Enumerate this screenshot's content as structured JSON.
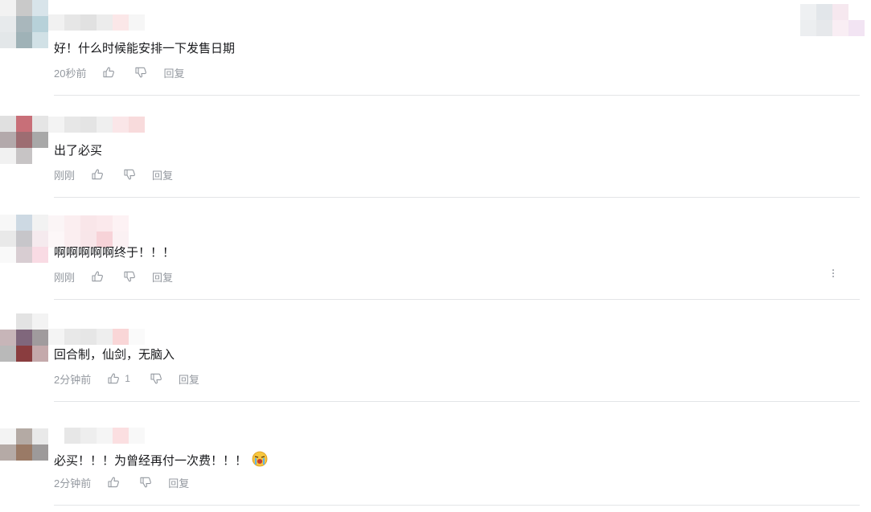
{
  "comments": [
    {
      "text": "好！什么时候能安排一下发售日期",
      "time": "20秒前",
      "like_count": "",
      "reply_label": "回复",
      "has_emoji": false,
      "show_more": false
    },
    {
      "text": "出了必买",
      "time": "刚刚",
      "like_count": "",
      "reply_label": "回复",
      "has_emoji": false,
      "show_more": false
    },
    {
      "text": "啊啊啊啊啊终于！！！",
      "time": "刚刚",
      "like_count": "",
      "reply_label": "回复",
      "has_emoji": false,
      "show_more": true
    },
    {
      "text": "回合制，仙剑，无脑入",
      "time": "2分钟前",
      "like_count": "1",
      "reply_label": "回复",
      "has_emoji": false,
      "show_more": false
    },
    {
      "text": "必买！！！为曾经再付一次费！！！",
      "time": "2分钟前",
      "like_count": "",
      "reply_label": "回复",
      "has_emoji": true,
      "show_more": false
    }
  ],
  "icons": {
    "like": "thumbs-up-icon",
    "dislike": "thumbs-down-icon",
    "more": "more-dots-icon",
    "emoji": "crying-emoji-icon"
  },
  "colors": {
    "text": "#18191c",
    "meta": "#9499a0",
    "divider": "#e3e5e7"
  }
}
